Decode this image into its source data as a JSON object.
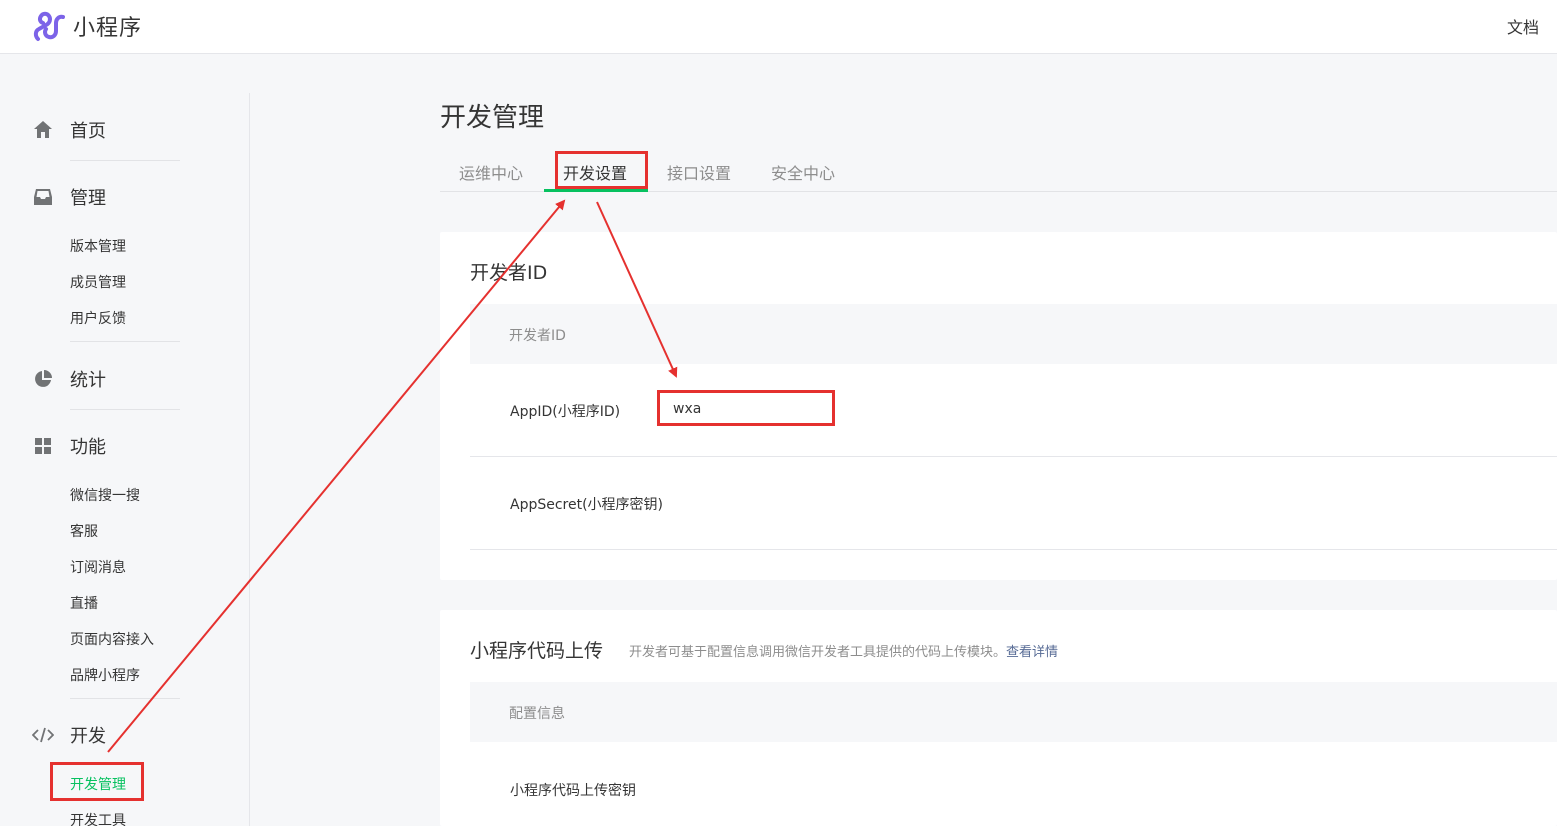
{
  "header": {
    "app_name": "小程序",
    "doc_link": "文档"
  },
  "sidebar": {
    "home": "首页",
    "manage": "管理",
    "manage_items": [
      "版本管理",
      "成员管理",
      "用户反馈"
    ],
    "stats": "统计",
    "features": "功能",
    "feature_items": [
      "微信搜一搜",
      "客服",
      "订阅消息",
      "直播",
      "页面内容接入",
      "品牌小程序"
    ],
    "dev": "开发",
    "dev_items": [
      "开发管理",
      "开发工具"
    ],
    "active_item": "开发管理"
  },
  "main": {
    "title": "开发管理",
    "tabs": [
      "运维中心",
      "开发设置",
      "接口设置",
      "安全中心"
    ],
    "active_tab": "开发设置",
    "developer_id_card": {
      "title": "开发者ID",
      "table_header": "开发者ID",
      "appid_label": "AppID(小程序ID)",
      "appid_value": "wxa",
      "appsecret_label": "AppSecret(小程序密钥)"
    },
    "upload_card": {
      "title": "小程序代码上传",
      "description": "开发者可基于配置信息调用微信开发者工具提供的代码上传模块。",
      "more_link": "查看详情",
      "table_header": "配置信息",
      "key_label": "小程序代码上传密钥"
    }
  },
  "colors": {
    "accent_green": "#07c160",
    "annotation_red": "#e5312f",
    "link_blue": "#576b95",
    "logo_purple": "#7c63e8"
  }
}
